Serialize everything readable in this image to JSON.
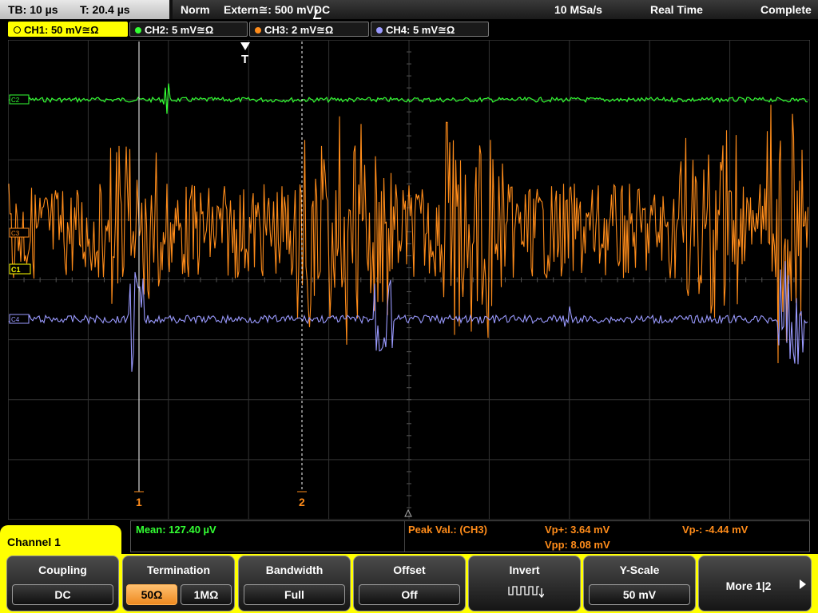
{
  "status": {
    "timebase": "TB: 10 µs",
    "trigger_time": "T: 20.4 µs",
    "mode": "Norm",
    "trigger_source": "Extern≅: 500 mV",
    "trigger_coupling": "DC",
    "sample_rate": "10 MSa/s",
    "acquisition": "Real Time",
    "state": "Complete"
  },
  "channels": [
    {
      "label": "CH1: 50 mV≅Ω",
      "color": "#ffff00",
      "active": true
    },
    {
      "label": "CH2: 5 mV≅Ω",
      "color": "#33ff33",
      "active": false
    },
    {
      "label": "CH3: 2 mV≅Ω",
      "color": "#ff8c1a",
      "active": false
    },
    {
      "label": "CH4: 5 mV≅Ω",
      "color": "#9a9aff",
      "active": false
    }
  ],
  "screen": {
    "trigger_marker": "T",
    "cursor1_label": "1",
    "cursor2_label": "2",
    "ch1_marker": "C1",
    "ch2_marker": "C2",
    "ch3_marker": "C3",
    "ch4_marker": "C4"
  },
  "measurements": {
    "mean": "Mean: 127.40 µV",
    "peak_label": "Peak Val.:  (CH3)",
    "vp_plus": "Vp+: 3.64 mV",
    "vp_minus": "Vp-: -4.44 mV",
    "vpp": "Vpp: 8.08 mV"
  },
  "channel_menu_title": "Channel 1",
  "softkeys": {
    "coupling": {
      "title": "Coupling",
      "value": "DC"
    },
    "termination": {
      "title": "Termination",
      "option_a": "50Ω",
      "option_b": "1MΩ",
      "selected": "50Ω"
    },
    "bandwidth": {
      "title": "Bandwidth",
      "value": "Full"
    },
    "offset": {
      "title": "Offset",
      "value": "Off"
    },
    "invert": {
      "title": "Invert",
      "icon": "invert-waveform-icon"
    },
    "yscale": {
      "title": "Y-Scale",
      "value": "50 mV"
    },
    "more": {
      "title": "More 1|2",
      "icon": "arrow-right-icon"
    }
  },
  "colors": {
    "ch1": "#ffff00",
    "ch2": "#33ff33",
    "ch3": "#ff8c1a",
    "ch4": "#9a9aff",
    "grid": "#3a3a3a"
  }
}
